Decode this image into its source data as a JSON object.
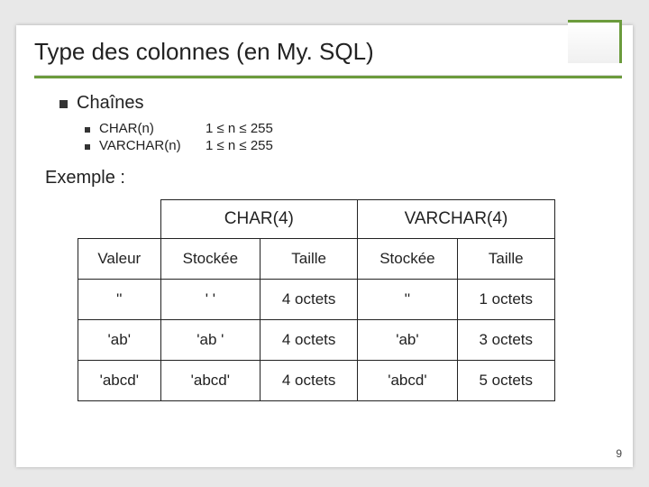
{
  "title": "Type des colonnes (en My. SQL)",
  "section": "Chaînes",
  "types": [
    {
      "name": "CHAR(n)",
      "range": "1 ≤ n ≤ 255"
    },
    {
      "name": "VARCHAR(n)",
      "range": "1 ≤ n ≤ 255"
    }
  ],
  "example_label": "Exemple :",
  "table": {
    "group_headers": [
      "CHAR(4)",
      "VARCHAR(4)"
    ],
    "col_headers": [
      "Valeur",
      "Stockée",
      "Taille",
      "Stockée",
      "Taille"
    ],
    "rows": [
      {
        "valeur": "''",
        "c_stock": "'    '",
        "c_taille": "4 octets",
        "v_stock": "''",
        "v_taille": "1 octets"
      },
      {
        "valeur": "'ab'",
        "c_stock": "'ab  '",
        "c_taille": "4 octets",
        "v_stock": "'ab'",
        "v_taille": "3 octets"
      },
      {
        "valeur": "'abcd'",
        "c_stock": "'abcd'",
        "c_taille": "4 octets",
        "v_stock": "'abcd'",
        "v_taille": "5 octets"
      }
    ]
  },
  "page_number": "9"
}
